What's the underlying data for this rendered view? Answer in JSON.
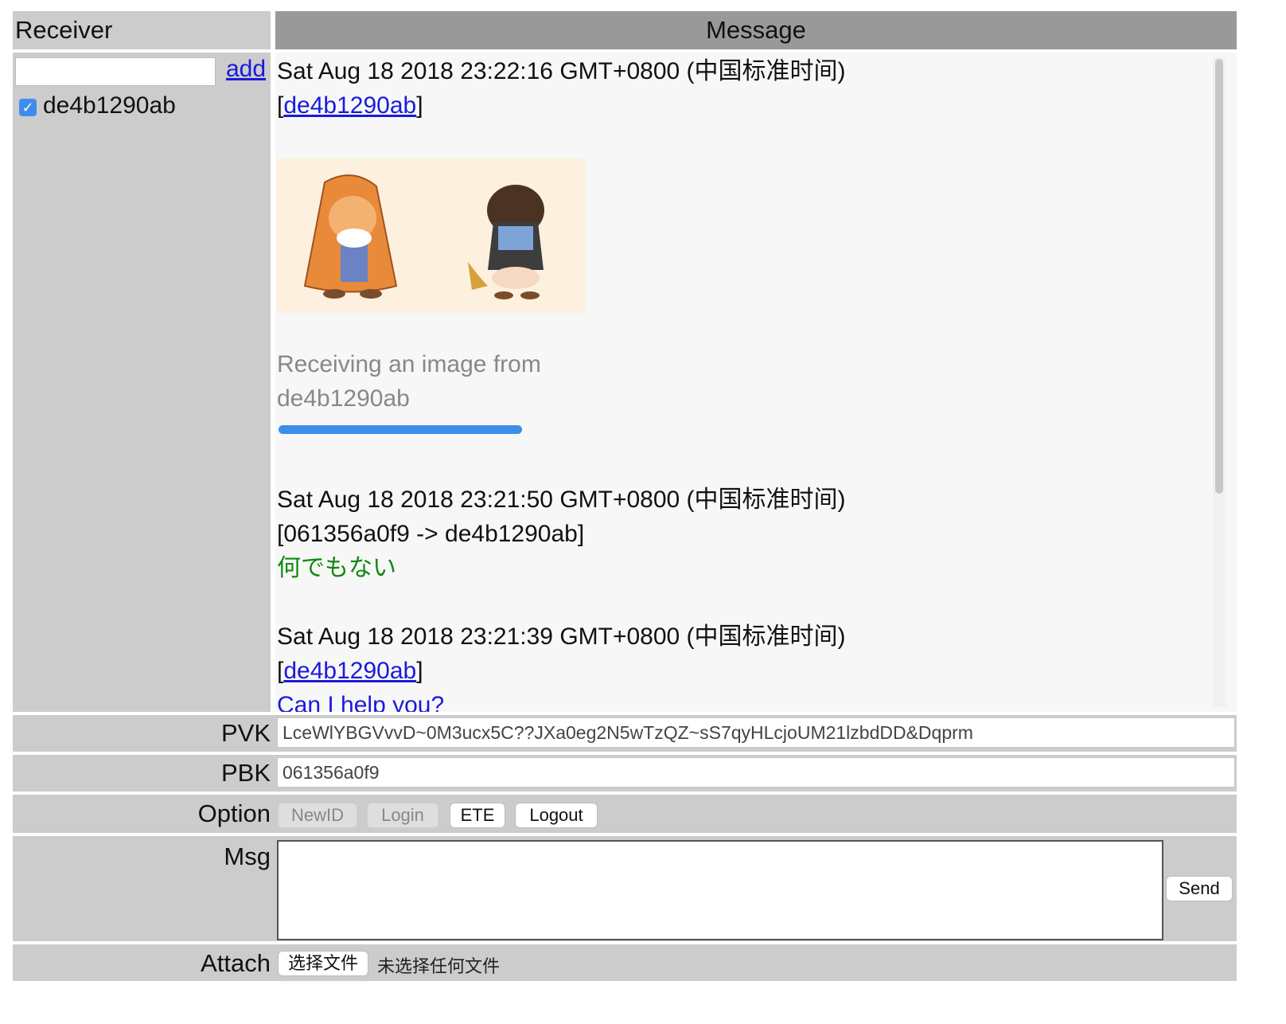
{
  "header": {
    "receiver": "Receiver",
    "message": "Message"
  },
  "receiver_panel": {
    "input_value": "",
    "add_label": "add",
    "items": [
      {
        "label": "de4b1290ab",
        "checked": true
      }
    ]
  },
  "messages": {
    "m1": {
      "timestamp": "Sat Aug 18 2018 23:22:16 GMT+0800 (中国标准时间)",
      "from": "de4b1290ab",
      "receiving_note_line1": "Receiving an image from",
      "receiving_note_line2": "de4b1290ab",
      "progress": 1.0
    },
    "m2": {
      "timestamp": "Sat Aug 18 2018 23:21:50 GMT+0800 (中国标准时间)",
      "route": "[061356a0f9 -> de4b1290ab]",
      "text": "何でもない"
    },
    "m3": {
      "timestamp": "Sat Aug 18 2018 23:21:39 GMT+0800 (中国标准时间)",
      "from": "de4b1290ab",
      "text": "Can I help you?"
    }
  },
  "form": {
    "pvk_label": "PVK",
    "pvk_value": "LceWlYBGVvvD~0M3ucx5C??JXa0eg2N5wTzQZ~sS7qyHLcjoUM21lzbdDD&Dqprm",
    "pbk_label": "PBK",
    "pbk_value": "061356a0f9",
    "option_label": "Option",
    "buttons": {
      "newid": "NewID",
      "login": "Login",
      "ete": "ETE",
      "logout": "Logout"
    },
    "msg_label": "Msg",
    "msg_value": "",
    "send_label": "Send",
    "attach_label": "Attach",
    "file_button": "选择文件",
    "file_status": "未选择任何文件"
  },
  "colors": {
    "link": "#1a1adc",
    "japanese_text": "#118811",
    "progress": "#3c8ee8",
    "checkbox": "#3f8cf0"
  }
}
